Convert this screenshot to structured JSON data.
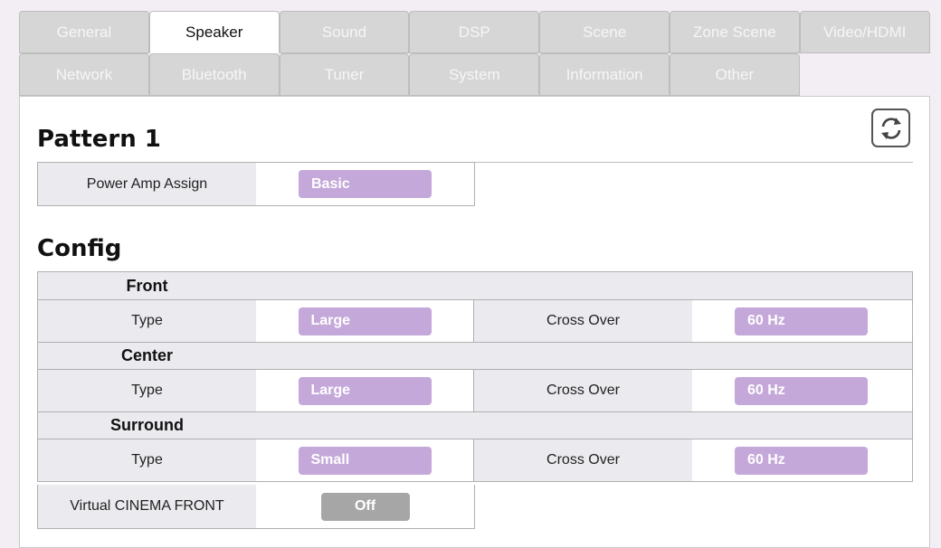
{
  "tabs": {
    "row1": [
      "General",
      "Speaker",
      "Sound",
      "DSP",
      "Scene",
      "Zone Scene",
      "Video/HDMI"
    ],
    "row2": [
      "Network",
      "Bluetooth",
      "Tuner",
      "System",
      "Information",
      "Other"
    ],
    "active": "Speaker"
  },
  "pattern": {
    "title": "Pattern 1",
    "power_amp_label": "Power Amp Assign",
    "power_amp_value": "Basic"
  },
  "config": {
    "title": "Config",
    "front": {
      "heading": "Front",
      "type_label": "Type",
      "type_value": "Large",
      "crossover_label": "Cross Over",
      "crossover_value": "60 Hz"
    },
    "center": {
      "heading": "Center",
      "type_label": "Type",
      "type_value": "Large",
      "crossover_label": "Cross Over",
      "crossover_value": "60 Hz"
    },
    "surround": {
      "heading": "Surround",
      "type_label": "Type",
      "type_value": "Small",
      "crossover_label": "Cross Over",
      "crossover_value": "60 Hz"
    },
    "virtual_cinema_front": {
      "label": "Virtual CINEMA FRONT",
      "value": "Off"
    }
  },
  "icons": {
    "refresh": "refresh-icon"
  },
  "colors": {
    "pill": "#c5a8da",
    "pill_off": "#a6a6a6",
    "tab_inactive": "#d6d6d6",
    "label_bg": "#ebebef"
  }
}
